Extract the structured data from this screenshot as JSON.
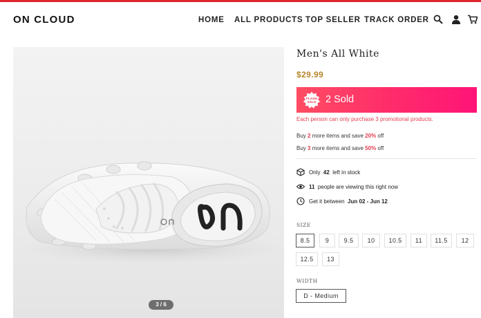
{
  "brand": {
    "name": "ON CLOUD",
    "accent_color": "#e0242c"
  },
  "nav": {
    "items": [
      "HOME",
      "ALL PRODUCTS",
      "TOP SELLER",
      "TRACK ORDER"
    ],
    "icons": [
      "search-icon",
      "account-icon",
      "cart-icon"
    ]
  },
  "gallery": {
    "counter": "3 / 6"
  },
  "product": {
    "title": "Men's All White",
    "price": "$29.99",
    "price_color": "#b7862b"
  },
  "flash": {
    "badge_line1": "FLASH",
    "badge_line2": "SALE",
    "sold": "2 Sold",
    "limit_note": "Each person can only purchase 3 promotional products."
  },
  "promos": [
    {
      "prefix": "Buy ",
      "qty": "2",
      "middle": " more items and save ",
      "pct": "20%",
      "suffix": " off"
    },
    {
      "prefix": "Buy ",
      "qty": "3",
      "middle": " more items and save ",
      "pct": "50%",
      "suffix": " off"
    }
  ],
  "info": {
    "stock_pre": "Only",
    "stock_num": "42",
    "stock_post": "left in stock",
    "view_num": "11",
    "view_post": "people are viewing this right now",
    "ship_pre": "Get it between",
    "ship_range": "Jun 02 - Jun 12"
  },
  "options": {
    "size_label": "SIZE",
    "sizes": [
      "8.5",
      "9",
      "9.5",
      "10",
      "10.5",
      "11",
      "11.5",
      "12",
      "12.5",
      "13"
    ],
    "selected_size": "8.5",
    "width_label": "WIDTH",
    "widths": [
      "D - Medium"
    ],
    "selected_width": "D - Medium"
  }
}
